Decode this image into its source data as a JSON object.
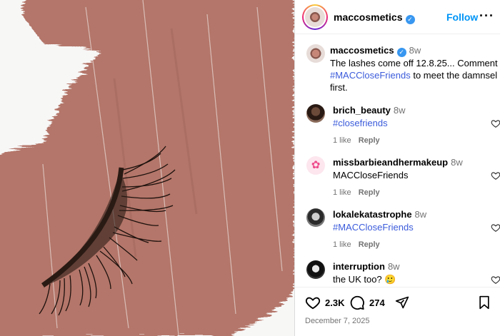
{
  "post": {
    "username": "maccosmetics",
    "follow_label": "Follow",
    "more_icon": "more-dots-icon",
    "caption_username": "maccosmetics",
    "caption_time": "8w",
    "caption_text_1": "The lashes come off 12.8.25... Comment",
    "caption_hashtag": "#MACCloseFriends",
    "caption_text_2": "to meet the damnsel first."
  },
  "comments": [
    {
      "username": "brich_beauty",
      "time": "8w",
      "text": "#closefriends",
      "is_tag": true,
      "likes": "1 like",
      "reply": "Reply"
    },
    {
      "username": "missbarbieandhermakeup",
      "time": "8w",
      "text": "MACCloseFriends",
      "is_tag": false,
      "likes": "1 like",
      "reply": "Reply"
    },
    {
      "username": "lokalekatastrophe",
      "time": "8w",
      "text": "#MACCloseFriends",
      "is_tag": true,
      "likes": "1 like",
      "reply": "Reply"
    },
    {
      "username": "interruption",
      "time": "8w",
      "text": "the UK too? 🥲",
      "is_tag": false,
      "likes": "",
      "reply": ""
    }
  ],
  "actions": {
    "likes": "2.3K",
    "comments": "274",
    "date": "December 7, 2025"
  },
  "colors": {
    "lipstick_swatch": "#b4766a",
    "link_blue": "#0095f6",
    "hashtag_blue": "#3b5bdb"
  }
}
